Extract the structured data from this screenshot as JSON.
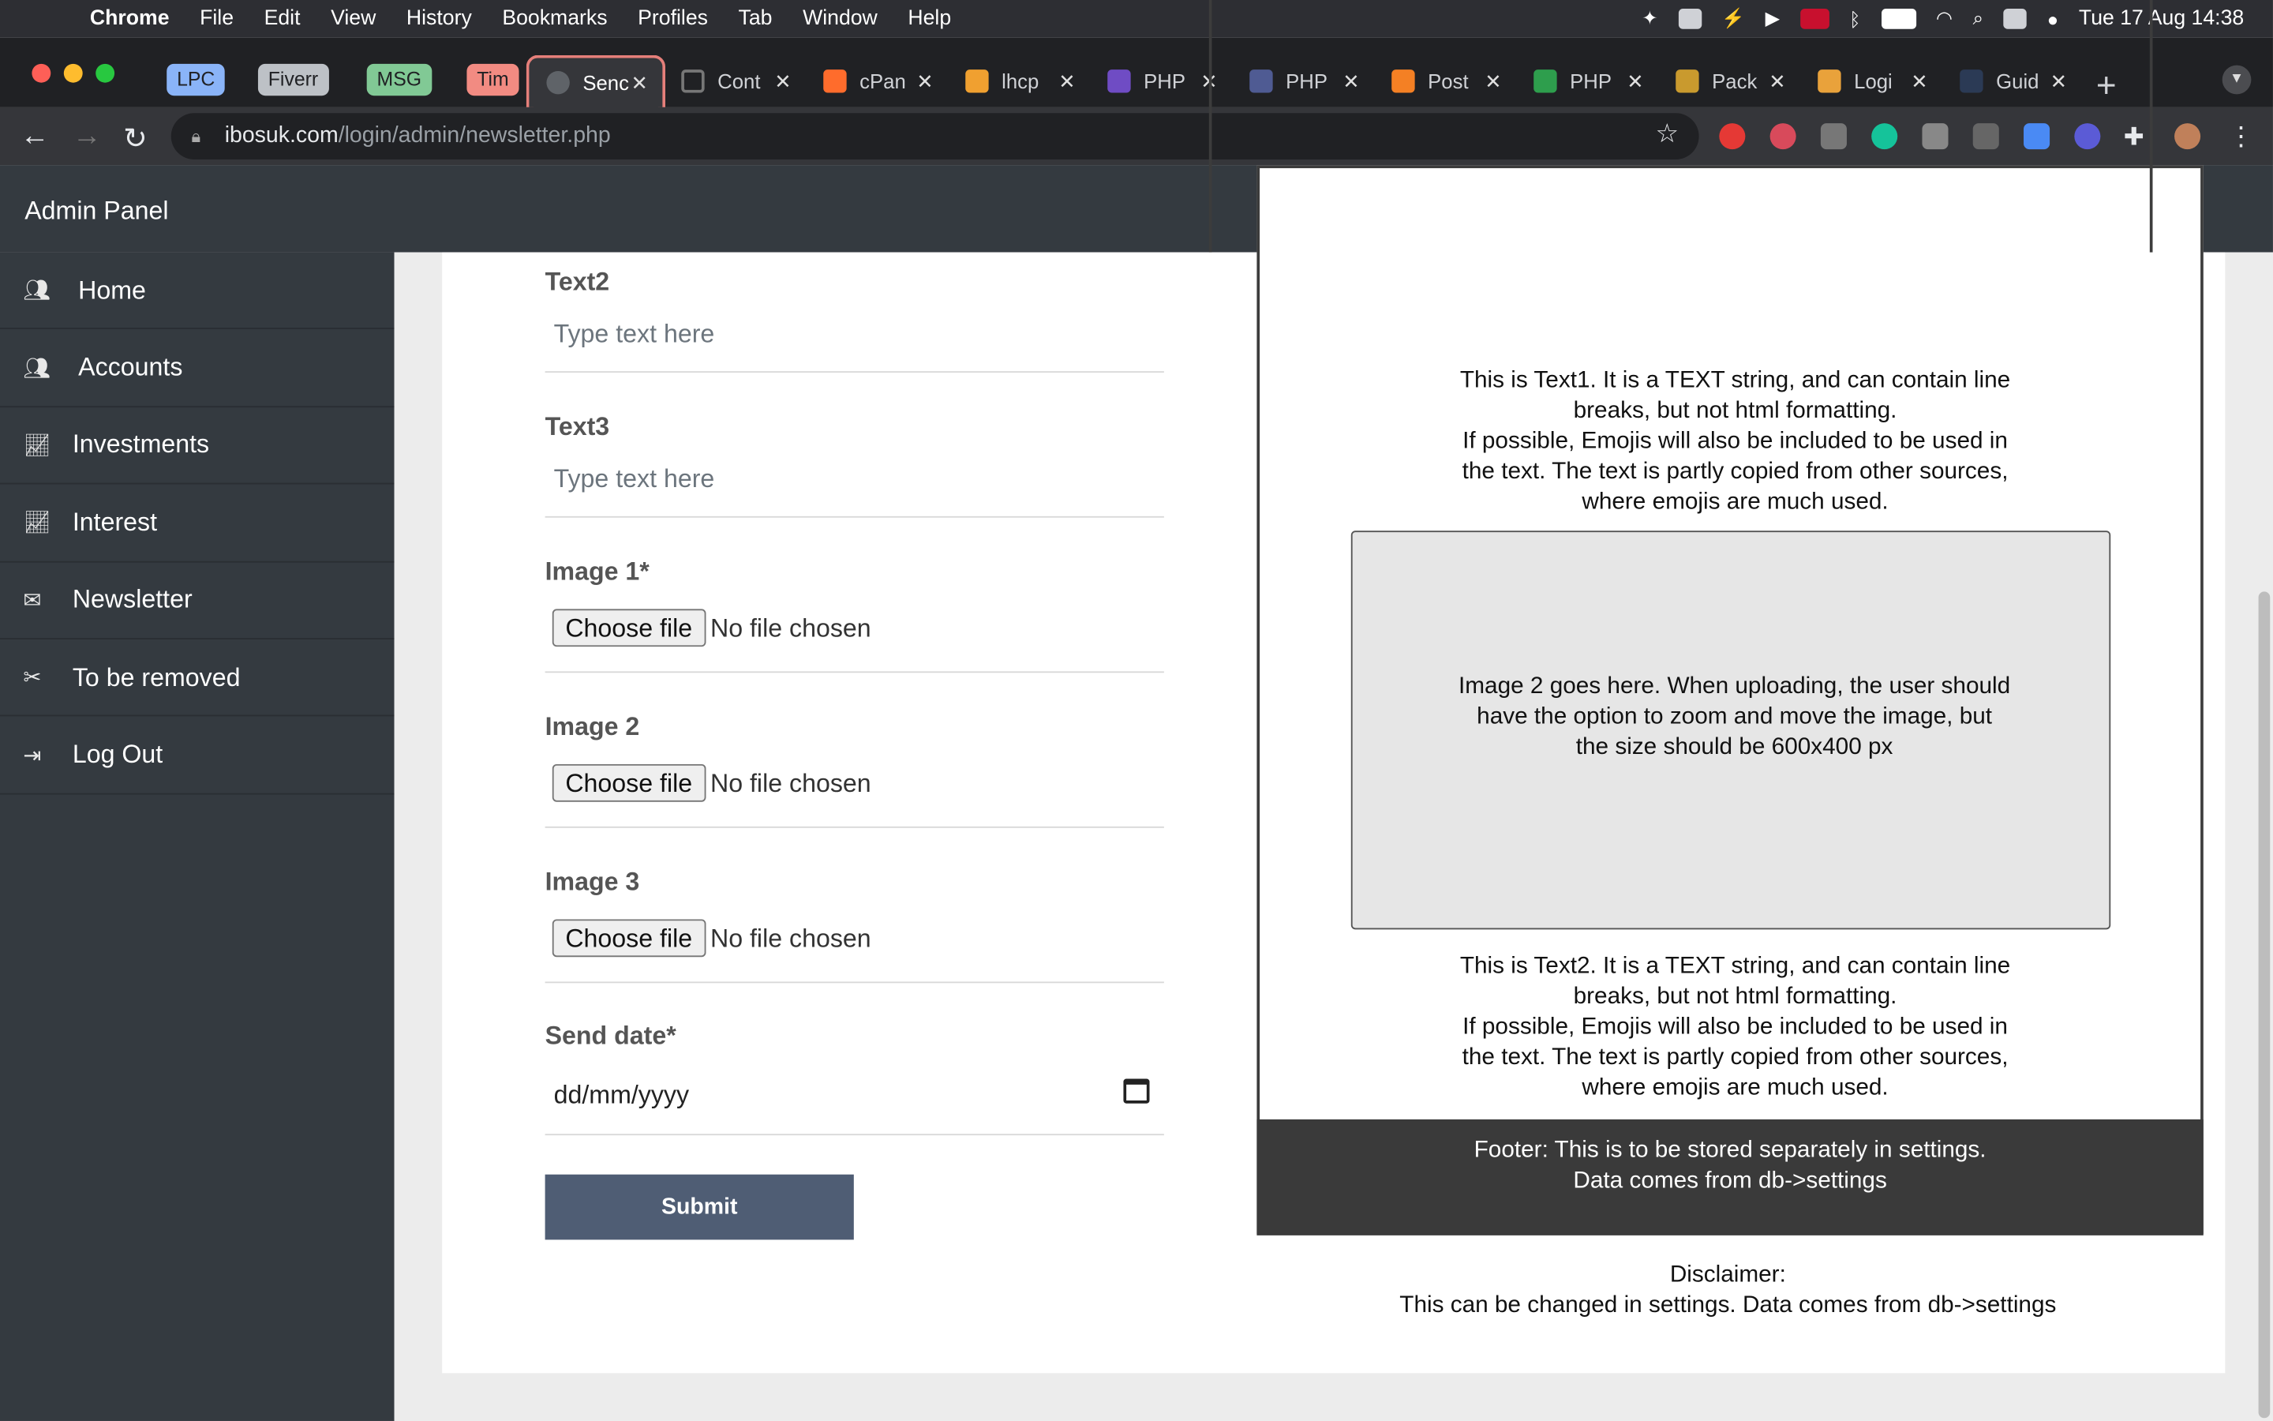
{
  "menubar": {
    "app": "Chrome",
    "items": [
      "File",
      "Edit",
      "View",
      "History",
      "Bookmarks",
      "Profiles",
      "Tab",
      "Window",
      "Help"
    ],
    "clock": "Tue 17 Aug  14:38"
  },
  "tab_groups": [
    {
      "label": "LPC",
      "color": "#8ab4f8"
    },
    {
      "label": "Fiverr",
      "color": "#bdc1c6"
    },
    {
      "label": "MSG",
      "color": "#81c995"
    },
    {
      "label": "Tim",
      "color": "#f28b82"
    }
  ],
  "tabs": [
    {
      "label": "Senc",
      "active": true
    },
    {
      "label": "Cont"
    },
    {
      "label": "cPan"
    },
    {
      "label": "lhcp"
    },
    {
      "label": "PHP"
    },
    {
      "label": "PHP"
    },
    {
      "label": "Post"
    },
    {
      "label": "PHP"
    },
    {
      "label": "Pack"
    },
    {
      "label": "Logi"
    },
    {
      "label": "Guid"
    }
  ],
  "url": {
    "host": "ibosuk.com",
    "path": "/login/admin/newsletter.php"
  },
  "app_title": "Admin Panel",
  "sidebar": {
    "items": [
      {
        "label": "Home",
        "icon": "users-icon"
      },
      {
        "label": "Accounts",
        "icon": "users-icon"
      },
      {
        "label": "Investments",
        "icon": "chart-line-icon"
      },
      {
        "label": "Interest",
        "icon": "chart-line-icon"
      },
      {
        "label": "Newsletter",
        "icon": "envelope-icon"
      },
      {
        "label": "To be removed",
        "icon": "tools-icon"
      },
      {
        "label": "Log Out",
        "icon": "sign-out-icon"
      }
    ]
  },
  "form": {
    "text2": {
      "label": "Text2",
      "placeholder": "Type text here"
    },
    "text3": {
      "label": "Text3",
      "placeholder": "Type text here"
    },
    "image1": {
      "label": "Image 1*",
      "button": "Choose file",
      "status": "No file chosen"
    },
    "image2": {
      "label": "Image 2",
      "button": "Choose file",
      "status": "No file chosen"
    },
    "image3": {
      "label": "Image 3",
      "button": "Choose file",
      "status": "No file chosen"
    },
    "send_date": {
      "label": "Send date*",
      "value": "dd/mm/yyyy"
    },
    "submit": "Submit"
  },
  "preview": {
    "text1": [
      "This is Text1. It is a TEXT string, and can contain line",
      "breaks, but not html formatting.",
      "If possible, Emojis will also be included to be used in",
      "the text. The text is partly copied from other sources,",
      "where emojis are much used."
    ],
    "image2": [
      "Image 2 goes here. When uploading, the user should",
      "have the option to zoom and move the image, but",
      "the size should be 600x400 px"
    ],
    "text2": [
      "This is Text2. It is a TEXT string, and can contain line",
      "breaks, but not html formatting.",
      "If possible, Emojis will also be included to be used in",
      "the text. The text is partly copied from other sources,",
      "where emojis are much used."
    ],
    "footer": [
      "Footer: This is to be stored separately in settings.",
      "Data comes from db->settings"
    ],
    "disclaimer": [
      "Disclaimer:",
      "This can be changed in settings. Data comes from db->settings"
    ]
  },
  "colors": {
    "sidebar": "#343a40",
    "submit": "#4f5d74",
    "preview_footer": "#3a3a3a",
    "active_tab_border": "#e57f7a"
  }
}
